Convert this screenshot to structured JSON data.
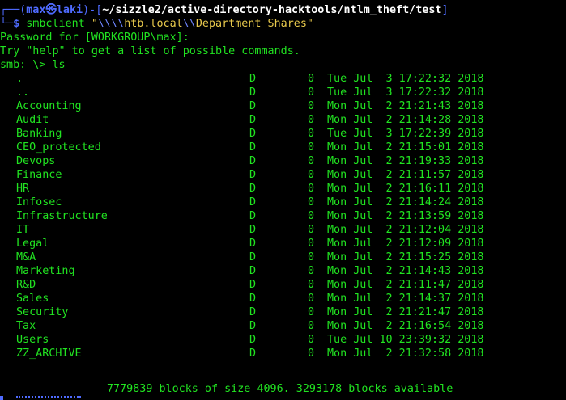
{
  "prompt": {
    "corner_top": "┌──(",
    "user": "max",
    "at_symbol": "㉿",
    "host": "laki",
    "dir_open": ")-[",
    "path": "~/sizzle2/active-directory-hacktools/ntlm_theft/test",
    "dir_close": "]",
    "corner_bottom": "└─",
    "dollar": "$ ",
    "command": "smbclient",
    "arg_quote_open": " \"",
    "arg_slashes": "\\\\\\\\",
    "arg_host": "htb.local",
    "arg_mid_slashes": "\\\\",
    "arg_share": "Department Shares\""
  },
  "output": {
    "password_line": "Password for [WORKGROUP\\max]:",
    "help_line": "Try \"help\" to get a list of possible commands.",
    "smb_prompt": "smb: \\> ls"
  },
  "listing": [
    {
      "name": ".",
      "type": "D",
      "size": "0",
      "date": "Tue Jul  3 17:22:32 2018"
    },
    {
      "name": "..",
      "type": "D",
      "size": "0",
      "date": "Tue Jul  3 17:22:32 2018"
    },
    {
      "name": "Accounting",
      "type": "D",
      "size": "0",
      "date": "Mon Jul  2 21:21:43 2018"
    },
    {
      "name": "Audit",
      "type": "D",
      "size": "0",
      "date": "Mon Jul  2 21:14:28 2018"
    },
    {
      "name": "Banking",
      "type": "D",
      "size": "0",
      "date": "Tue Jul  3 17:22:39 2018"
    },
    {
      "name": "CEO_protected",
      "type": "D",
      "size": "0",
      "date": "Mon Jul  2 21:15:01 2018"
    },
    {
      "name": "Devops",
      "type": "D",
      "size": "0",
      "date": "Mon Jul  2 21:19:33 2018"
    },
    {
      "name": "Finance",
      "type": "D",
      "size": "0",
      "date": "Mon Jul  2 21:11:57 2018"
    },
    {
      "name": "HR",
      "type": "D",
      "size": "0",
      "date": "Mon Jul  2 21:16:11 2018"
    },
    {
      "name": "Infosec",
      "type": "D",
      "size": "0",
      "date": "Mon Jul  2 21:14:24 2018"
    },
    {
      "name": "Infrastructure",
      "type": "D",
      "size": "0",
      "date": "Mon Jul  2 21:13:59 2018"
    },
    {
      "name": "IT",
      "type": "D",
      "size": "0",
      "date": "Mon Jul  2 21:12:04 2018"
    },
    {
      "name": "Legal",
      "type": "D",
      "size": "0",
      "date": "Mon Jul  2 21:12:09 2018"
    },
    {
      "name": "M&A",
      "type": "D",
      "size": "0",
      "date": "Mon Jul  2 21:15:25 2018"
    },
    {
      "name": "Marketing",
      "type": "D",
      "size": "0",
      "date": "Mon Jul  2 21:14:43 2018"
    },
    {
      "name": "R&D",
      "type": "D",
      "size": "0",
      "date": "Mon Jul  2 21:11:47 2018"
    },
    {
      "name": "Sales",
      "type": "D",
      "size": "0",
      "date": "Mon Jul  2 21:14:37 2018"
    },
    {
      "name": "Security",
      "type": "D",
      "size": "0",
      "date": "Mon Jul  2 21:21:47 2018"
    },
    {
      "name": "Tax",
      "type": "D",
      "size": "0",
      "date": "Mon Jul  2 21:16:54 2018"
    },
    {
      "name": "Users",
      "type": "D",
      "size": "0",
      "date": "Tue Jul 10 23:39:32 2018"
    },
    {
      "name": "ZZ_ARCHIVE",
      "type": "D",
      "size": "0",
      "date": "Mon Jul  2 21:32:58 2018"
    }
  ],
  "summary": "7779839 blocks of size 4096. 3293178 blocks available",
  "colors": {
    "background": "#000000",
    "output_text": "#21e321",
    "prompt_accent": "#4f6bff",
    "path_text": "#ffffff",
    "string_quote": "#e8c94c"
  }
}
